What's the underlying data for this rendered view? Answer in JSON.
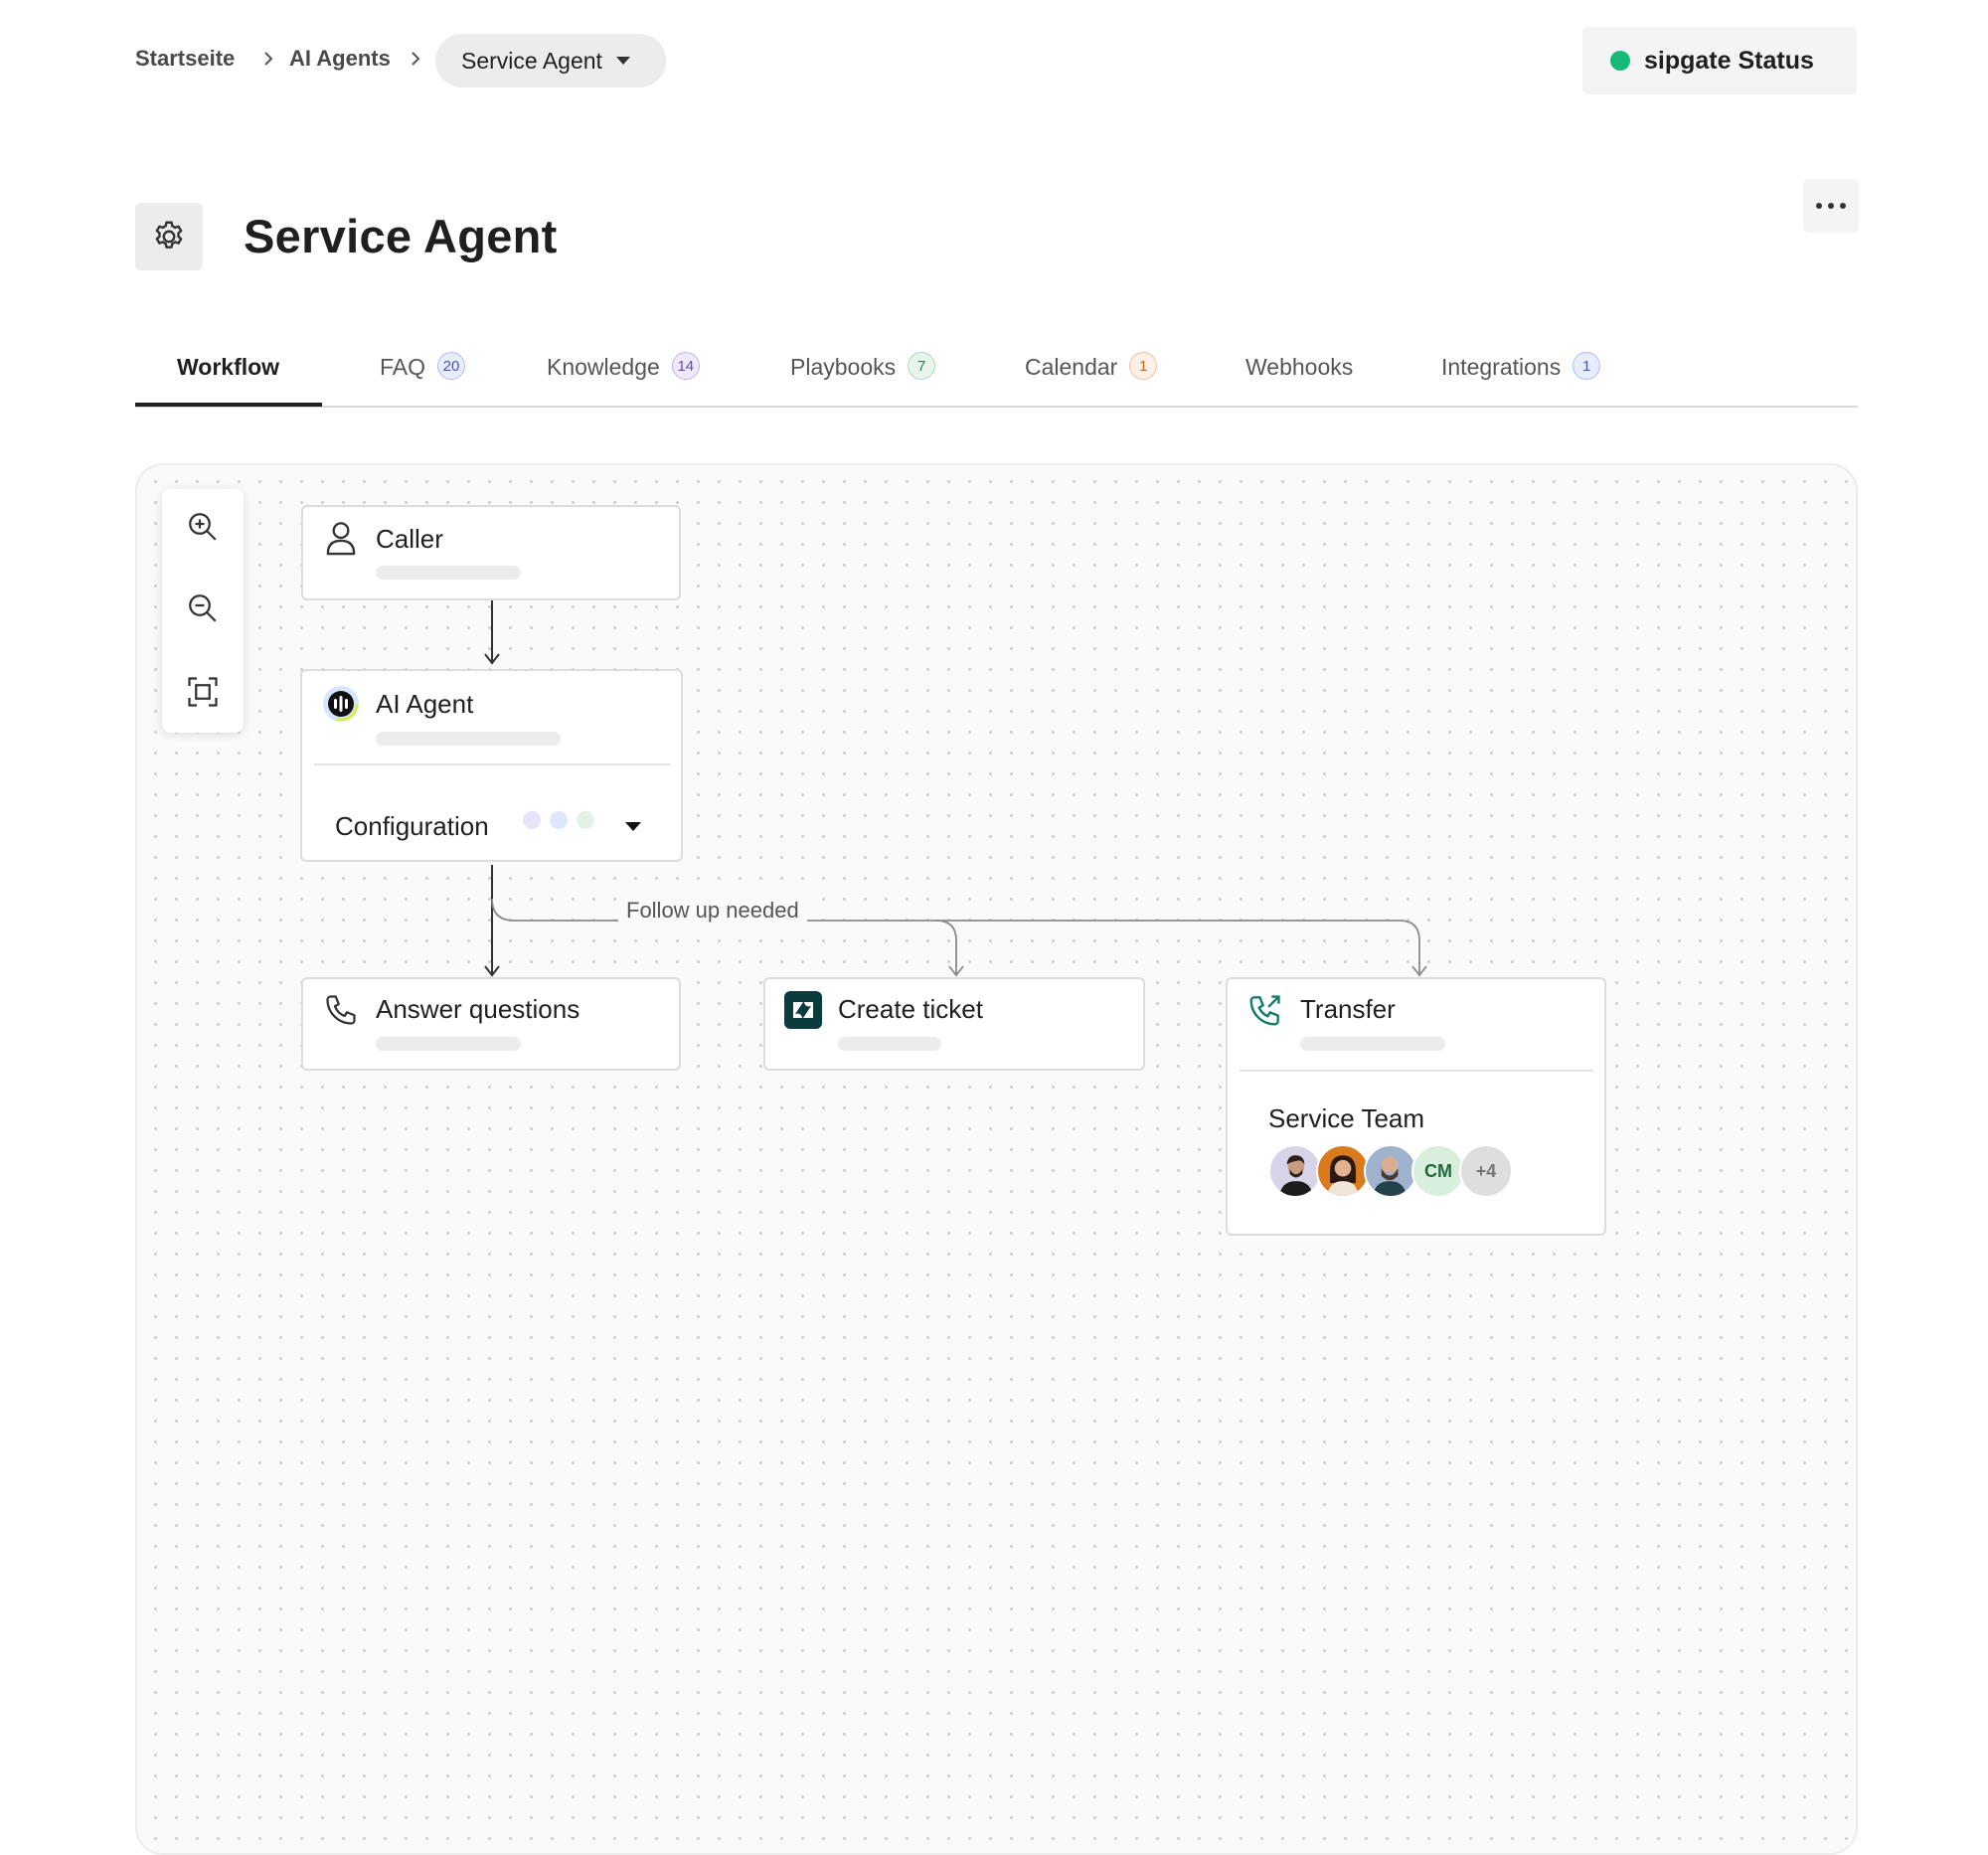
{
  "breadcrumb": {
    "home": "Startseite",
    "section": "AI Agents",
    "current": "Service Agent"
  },
  "status_button": {
    "label": "sipgate Status",
    "indicator_color": "#17b978"
  },
  "page": {
    "title": "Service Agent"
  },
  "tabs": [
    {
      "label": "Workflow",
      "badge": null,
      "active": true
    },
    {
      "label": "FAQ",
      "badge": "20",
      "badge_color": "#4058b8"
    },
    {
      "label": "Knowledge",
      "badge": "14",
      "badge_color": "#6b44c2"
    },
    {
      "label": "Playbooks",
      "badge": "7",
      "badge_color": "#2f7d48"
    },
    {
      "label": "Calendar",
      "badge": "1",
      "badge_color": "#c06420"
    },
    {
      "label": "Webhooks",
      "badge": null
    },
    {
      "label": "Integrations",
      "badge": "1",
      "badge_color": "#4058b8"
    }
  ],
  "zoom_controls": [
    {
      "icon": "zoom-in-icon"
    },
    {
      "icon": "zoom-out-icon"
    },
    {
      "icon": "fit-view-icon"
    }
  ],
  "workflow": {
    "caller": {
      "title": "Caller",
      "icon": "user-icon"
    },
    "ai_agent": {
      "title": "AI Agent",
      "icon": "ai-agent-logo-icon",
      "config_label": "Configuration",
      "config_dots": [
        "#e6e3fb",
        "#dde6fb",
        "#e3f1e6"
      ]
    },
    "edge_label": "Follow up needed",
    "answer": {
      "title": "Answer questions",
      "icon": "phone-icon"
    },
    "ticket": {
      "title": "Create ticket",
      "icon": "zendesk-icon"
    },
    "transfer": {
      "title": "Transfer",
      "icon": "phone-transfer-icon",
      "team_name": "Service Team",
      "initials": "CM",
      "more_count": "+4"
    }
  }
}
